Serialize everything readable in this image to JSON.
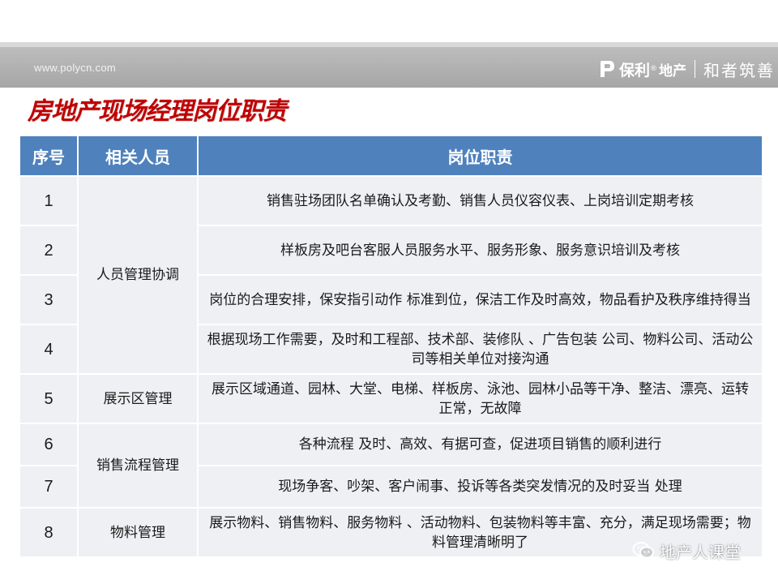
{
  "header": {
    "website": "www.polycn.com",
    "brand_name": "保利",
    "brand_reg": "®",
    "brand_sub": "地产",
    "slogan": "和者筑善"
  },
  "title": "房地产现场经理岗位职责",
  "table": {
    "columns": [
      "序号",
      "相关人员",
      "岗位职责"
    ],
    "rows": [
      {
        "num": "1",
        "group": "人员管理协调",
        "duty": "销售驻场团队名单确认及考勤、销售人员仪容仪表、上岗培训定期考核"
      },
      {
        "num": "2",
        "group": "人员管理协调",
        "duty": "样板房及吧台客服人员服务水平、服务形象、服务意识培训及考核"
      },
      {
        "num": "3",
        "group": "人员管理协调",
        "duty": "岗位的合理安排，保安指引动作 标准到位，保洁工作及时高效，物品看护及秩序维持得当"
      },
      {
        "num": "4",
        "group": "人员管理协调",
        "duty": "根据现场工作需要，及时和工程部、技术部、装修队 、广告包装 公司、物料公司、活动公司等相关单位对接沟通"
      },
      {
        "num": "5",
        "group": "展示区管理",
        "duty": "展示区域通道、园林、大堂、电梯、样板房、泳池、园林小品等干净、整洁、漂亮、运转正常，无故障"
      },
      {
        "num": "6",
        "group": "销售流程管理",
        "duty": "各种流程 及时、高效、有据可查，促进项目销售的顺利进行"
      },
      {
        "num": "7",
        "group": "销售流程管理",
        "duty": "现场争客、吵架、客户闹事、投诉等各类突发情况的及时妥当 处理"
      },
      {
        "num": "8",
        "group": "物料管理",
        "duty": "展示物料、销售物料、服务物料 、活动物料、包装物料等丰富、充分，满足现场需要；物料管理清晰明了"
      }
    ]
  },
  "watermark": "地产人课堂",
  "colors": {
    "title_red": "#c00000",
    "header_blue": "#4f81bd",
    "cell_bg": "#eef0f4",
    "header_bar_gray": "#a6a6a6"
  }
}
